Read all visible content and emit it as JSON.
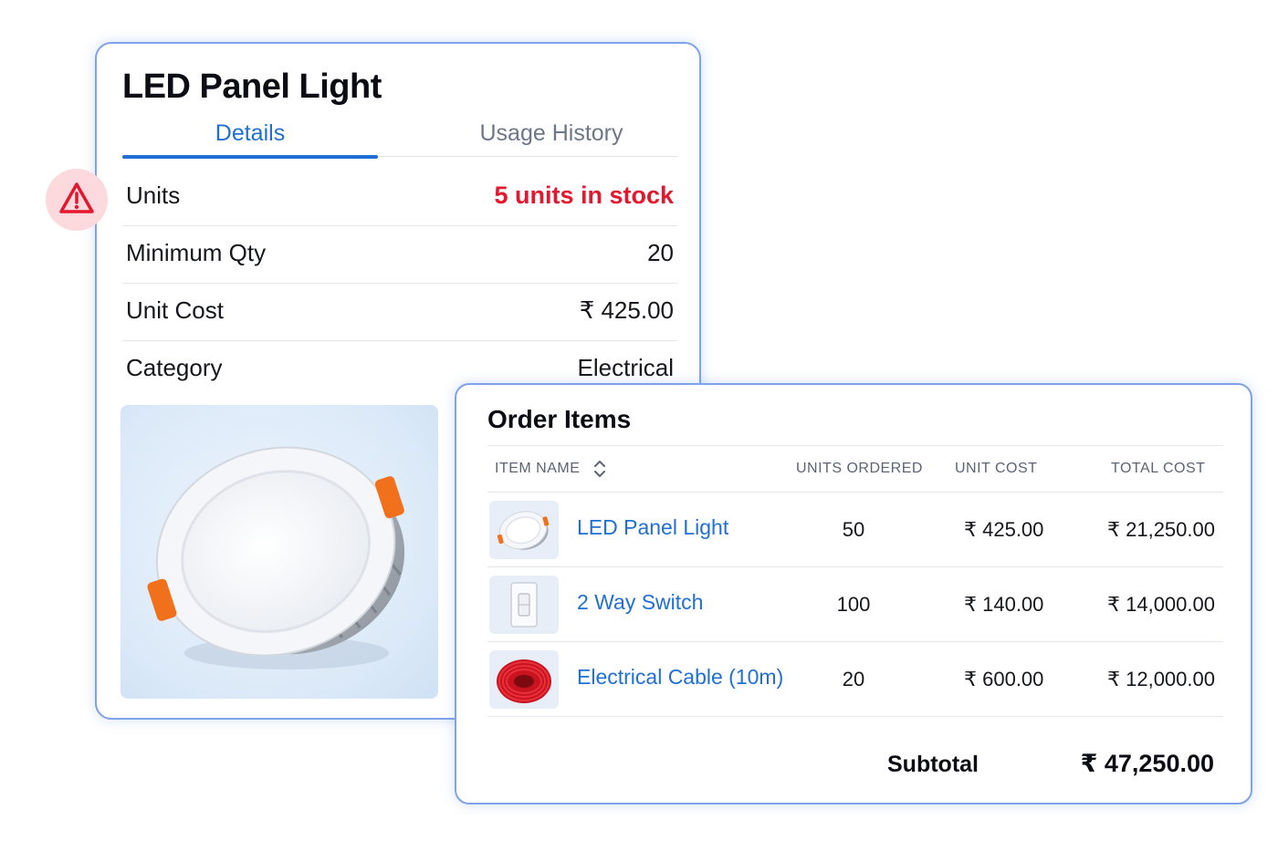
{
  "product": {
    "title": "LED Panel Light",
    "tabs": [
      {
        "label": "Details",
        "active": true
      },
      {
        "label": "Usage History",
        "active": false
      }
    ],
    "details": [
      {
        "label": "Units",
        "value": "5 units in stock",
        "alert": true
      },
      {
        "label": "Minimum Qty",
        "value": "20"
      },
      {
        "label": "Unit Cost",
        "value": "₹ 425.00"
      },
      {
        "label": "Category",
        "value": "Electrical"
      }
    ],
    "image_icon": "led-panel-light-image",
    "warning_icon": "warning-triangle-icon"
  },
  "order": {
    "title": "Order Items",
    "columns": {
      "item_name": "ITEM NAME",
      "units_ordered": "UNITS ORDERED",
      "unit_cost": "UNIT COST",
      "total_cost": "TOTAL COST"
    },
    "items": [
      {
        "name": "LED Panel Light",
        "units": "50",
        "unit_cost": "₹ 425.00",
        "total_cost": "₹ 21,250.00",
        "thumb_icon": "led-panel-light-thumb"
      },
      {
        "name": "2 Way Switch",
        "units": "100",
        "unit_cost": "₹ 140.00",
        "total_cost": "₹ 14,000.00",
        "thumb_icon": "switch-thumb"
      },
      {
        "name": "Electrical Cable (10m)",
        "units": "20",
        "unit_cost": "₹ 600.00",
        "total_cost": "₹ 12,000.00",
        "thumb_icon": "cable-coil-thumb"
      }
    ],
    "subtotal_label": "Subtotal",
    "subtotal_value": "₹ 47,250.00"
  },
  "colors": {
    "accent": "#1f6fd6",
    "alert": "#e4172e",
    "card_border": "#7fa3ea",
    "warning_bg": "#fcd9dd"
  }
}
